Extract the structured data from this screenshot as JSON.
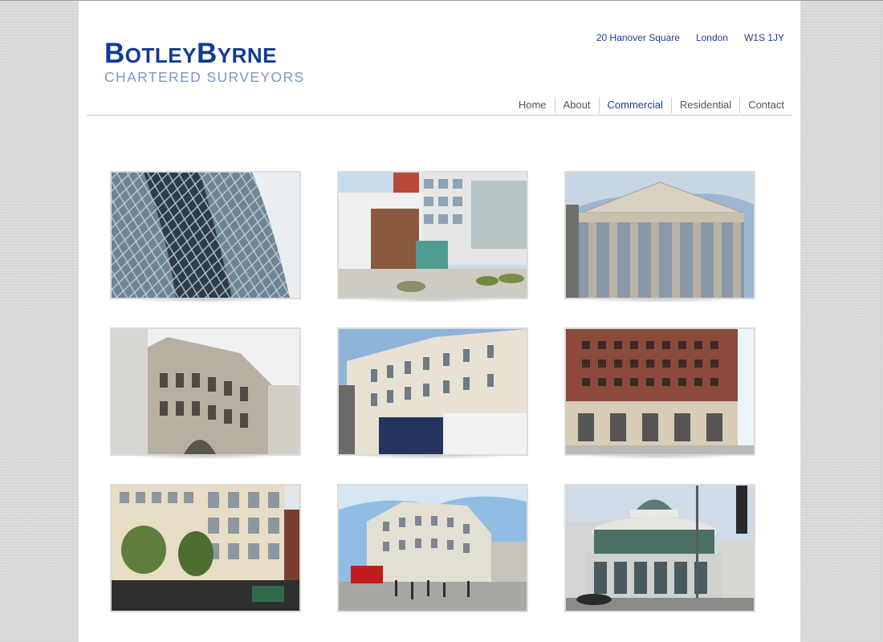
{
  "brand": {
    "name_part1_initial": "B",
    "name_part1_rest": "OTLEY",
    "name_part2_initial": "B",
    "name_part2_rest": "YRNE",
    "tagline": "CHARTERED SURVEYORS",
    "color": "#113b94",
    "tagline_color": "#7f96c9"
  },
  "address": {
    "street": "20 Hanover Square",
    "city": "London",
    "postcode": "W1S 1JY"
  },
  "nav": {
    "items": [
      {
        "label": "Home"
      },
      {
        "label": "About"
      },
      {
        "label": "Commercial",
        "active": true
      },
      {
        "label": "Residential"
      },
      {
        "label": "Contact"
      }
    ]
  },
  "gallery": {
    "images": [
      {
        "subject": "gherkin-tower-glass"
      },
      {
        "subject": "modern-courtyard-building"
      },
      {
        "subject": "royal-exchange-columns"
      },
      {
        "subject": "victorian-corner-building"
      },
      {
        "subject": "cream-terrace-shops"
      },
      {
        "subject": "red-brick-office-block"
      },
      {
        "subject": "oxford-street-office"
      },
      {
        "subject": "oxford-circus-street"
      },
      {
        "subject": "domed-market-building"
      }
    ]
  }
}
